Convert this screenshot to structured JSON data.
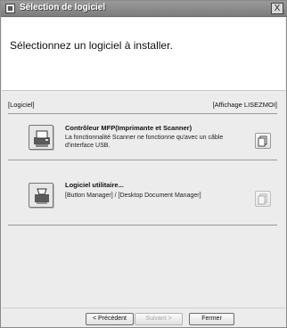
{
  "window": {
    "title": "Sélection de logiciel",
    "close_label": "X"
  },
  "header": {
    "heading": "Sélectionnez un logiciel à installer."
  },
  "list": {
    "left_label": "[Logiciel]",
    "right_label": "[Affichage LISEZMOI]",
    "items": [
      {
        "title": "Contrôleur MFP(Imprimante et Scanner)",
        "desc_line1": "La fonctionnalité Scanner ne fonctionne qu'avec un câble",
        "desc_line2": "d'interface USB.",
        "icon": "printer-scanner-icon",
        "readme_enabled": true
      },
      {
        "title": "Logiciel utilitaire...",
        "desc_line1": "[Button Manager] / [Desktop Document Manager]",
        "icon": "utility-software-icon",
        "readme_enabled": false
      }
    ]
  },
  "footer": {
    "back_label": "< Précédent",
    "next_label": "Suivant >",
    "close_label": "Fermer"
  }
}
